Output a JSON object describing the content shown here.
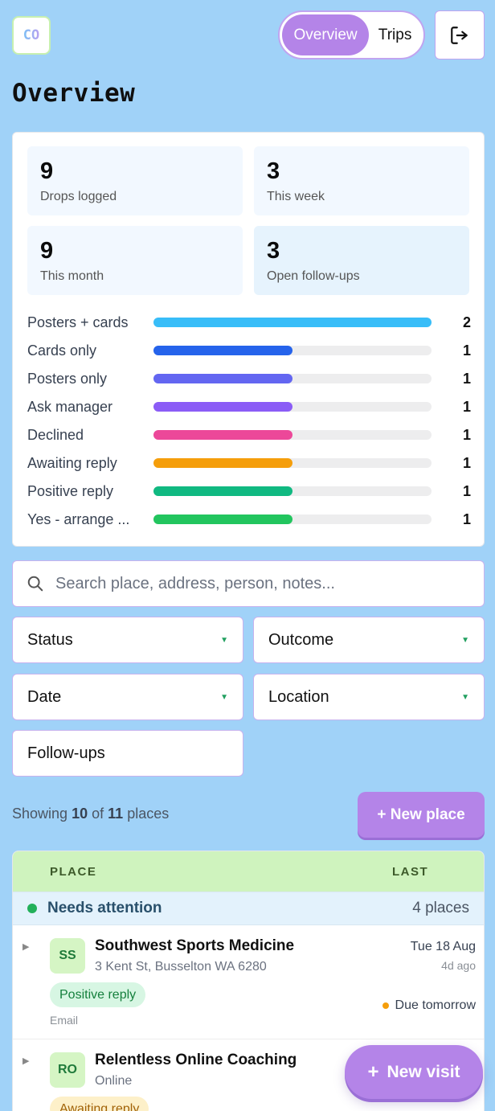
{
  "app": {
    "logo_text": "CO"
  },
  "nav": {
    "tabs": [
      {
        "label": "Overview",
        "active": true
      },
      {
        "label": "Trips",
        "active": false
      }
    ]
  },
  "page": {
    "title": "Overview"
  },
  "stats": [
    {
      "value": "9",
      "label": "Drops logged"
    },
    {
      "value": "3",
      "label": "This week"
    },
    {
      "value": "9",
      "label": "This month"
    },
    {
      "value": "3",
      "label": "Open follow-ups"
    }
  ],
  "breakdown": {
    "max": 2,
    "rows": [
      {
        "label": "Posters + cards",
        "count": 2,
        "color": "#38bdf8"
      },
      {
        "label": "Cards only",
        "count": 1,
        "color": "#2563eb"
      },
      {
        "label": "Posters only",
        "count": 1,
        "color": "#6366f1"
      },
      {
        "label": "Ask manager",
        "count": 1,
        "color": "#8b5cf6"
      },
      {
        "label": "Declined",
        "count": 1,
        "color": "#ec4899"
      },
      {
        "label": "Awaiting reply",
        "count": 1,
        "color": "#f59e0b"
      },
      {
        "label": "Positive reply",
        "count": 1,
        "color": "#10b981"
      },
      {
        "label": "Yes - arrange ...",
        "count": 1,
        "color": "#22c55e"
      }
    ]
  },
  "search": {
    "placeholder": "Search place, address, person, notes..."
  },
  "filters": {
    "status": "Status",
    "outcome": "Outcome",
    "date": "Date",
    "location": "Location",
    "followups": "Follow-ups"
  },
  "summary": {
    "prefix": "Showing",
    "shown": "10",
    "of": "of",
    "total": "11",
    "suffix": "places"
  },
  "new_place_label": "+ New place",
  "table": {
    "columns": {
      "place": "PLACE",
      "last": "LAST"
    },
    "group": {
      "title": "Needs attention",
      "count": "4 places"
    },
    "rows": [
      {
        "initials": "SS",
        "name": "Southwest Sports Medicine",
        "address": "3 Kent St, Busselton WA 6280",
        "date": "Tue 18 Aug",
        "ago": "4d ago",
        "tag": "Positive reply",
        "method": "Email",
        "due": "Due tomorrow"
      },
      {
        "initials": "RO",
        "name": "Relentless Online Coaching",
        "address": "Online",
        "tag": "Awaiting reply"
      }
    ]
  },
  "fab": {
    "label": "New visit"
  }
}
